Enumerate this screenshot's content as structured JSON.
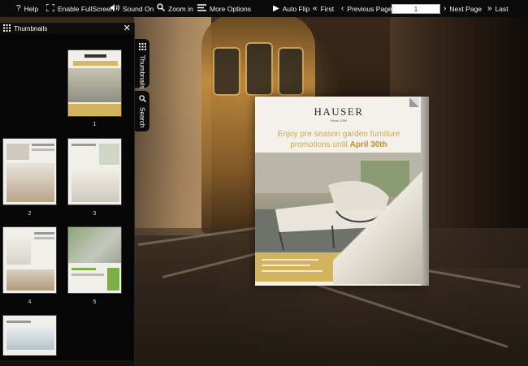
{
  "toolbar": {
    "help": "Help",
    "fullscreen": "Enable FullScreen",
    "sound": "Sound On",
    "zoom": "Zoom in",
    "more": "More Options",
    "auto_flip": "Auto Flip",
    "first": "First",
    "previous": "Previous Page",
    "page_value": "1",
    "next": "Next Page",
    "last": "Last"
  },
  "panel": {
    "title": "Thumbnails",
    "thumbs": [
      {
        "label": "1"
      },
      {
        "label": "2"
      },
      {
        "label": "3"
      },
      {
        "label": "4"
      },
      {
        "label": "5"
      }
    ]
  },
  "tabs": {
    "thumbnails": "Thumbnails",
    "search": "Search"
  },
  "book": {
    "brand": "HAUSER",
    "brand_sub": "Since 1939",
    "headline_1": "Enjoy pre season garden furniture",
    "headline_2": "promotions until",
    "headline_date": "April 30th"
  },
  "colors": {
    "toolbar_bg": "#0b0b0b",
    "panel_bg": "#060606",
    "accent_gold": "#c9a84f"
  }
}
